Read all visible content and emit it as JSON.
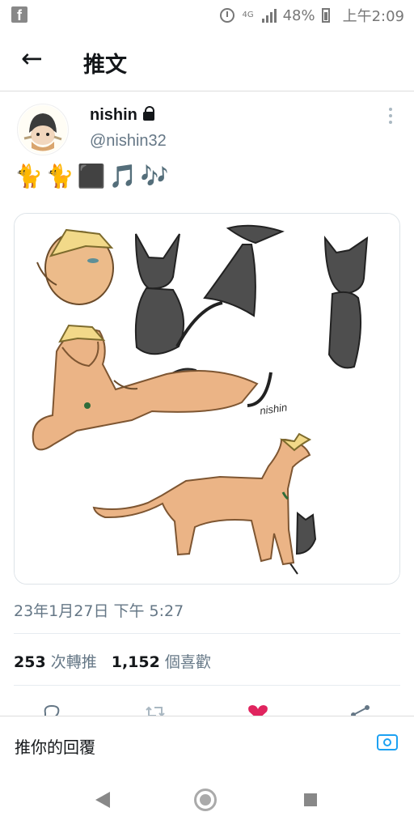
{
  "status_bar": {
    "app_icon": "facebook-icon",
    "battery": "48%",
    "time": "上午2:09",
    "network": "4G"
  },
  "header": {
    "title": "推文",
    "back_icon": "arrow-left-icon"
  },
  "tweet": {
    "display_name": "nishin",
    "handle": "@nishin32",
    "text_emojis": [
      "🐈",
      "🐈",
      "⬛",
      "🎵",
      "🎶"
    ],
    "timestamp": "23年1月27日 下午 5:27",
    "retweets_count": "253",
    "retweets_label": "次轉推",
    "likes_count": "1,152",
    "likes_label": "個喜歡"
  },
  "actions": [
    "reply-icon",
    "retweet-icon",
    "like-icon",
    "share-icon"
  ],
  "reply": {
    "placeholder": "推你的回覆"
  },
  "colors": {
    "accent": "#1da1f2",
    "like": "#e0245e",
    "text": "#14171a",
    "muted": "#657786"
  }
}
